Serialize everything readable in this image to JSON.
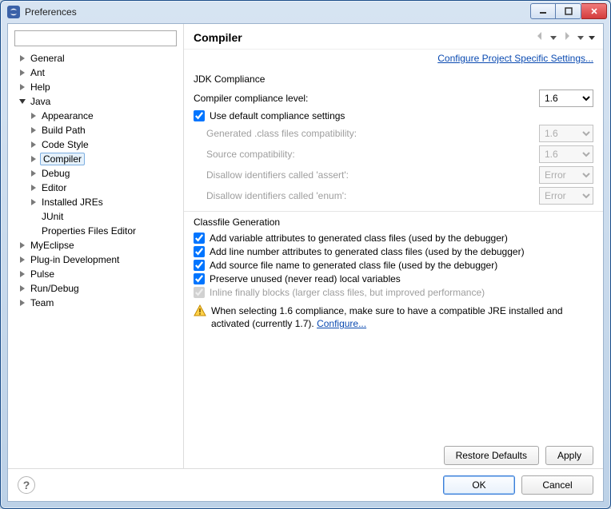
{
  "window": {
    "title": "Preferences"
  },
  "sidebar": {
    "filter_placeholder": "",
    "items": [
      {
        "label": "General",
        "expanded": false,
        "depth": 0
      },
      {
        "label": "Ant",
        "expanded": false,
        "depth": 0
      },
      {
        "label": "Help",
        "expanded": false,
        "depth": 0
      },
      {
        "label": "Java",
        "expanded": true,
        "depth": 0
      },
      {
        "label": "Appearance",
        "expanded": false,
        "depth": 1
      },
      {
        "label": "Build Path",
        "expanded": false,
        "depth": 1
      },
      {
        "label": "Code Style",
        "expanded": false,
        "depth": 1
      },
      {
        "label": "Compiler",
        "expanded": false,
        "depth": 1,
        "selected": true
      },
      {
        "label": "Debug",
        "expanded": false,
        "depth": 1
      },
      {
        "label": "Editor",
        "expanded": false,
        "depth": 1
      },
      {
        "label": "Installed JREs",
        "expanded": false,
        "depth": 1
      },
      {
        "label": "JUnit",
        "leaf": true,
        "depth": 1
      },
      {
        "label": "Properties Files Editor",
        "leaf": true,
        "depth": 1
      },
      {
        "label": "MyEclipse",
        "expanded": false,
        "depth": 0
      },
      {
        "label": "Plug-in Development",
        "expanded": false,
        "depth": 0
      },
      {
        "label": "Pulse",
        "expanded": false,
        "depth": 0
      },
      {
        "label": "Run/Debug",
        "expanded": false,
        "depth": 0
      },
      {
        "label": "Team",
        "expanded": false,
        "depth": 0
      }
    ]
  },
  "panel": {
    "title": "Compiler",
    "config_link": "Configure Project Specific Settings...",
    "jdk": {
      "group_title": "JDK Compliance",
      "compliance_label": "Compiler compliance level:",
      "compliance_value": "1.6",
      "use_default_label": "Use default compliance settings",
      "generated_label": "Generated .class files compatibility:",
      "generated_value": "1.6",
      "source_label": "Source compatibility:",
      "source_value": "1.6",
      "assert_label": "Disallow identifiers called 'assert':",
      "assert_value": "Error",
      "enum_label": "Disallow identifiers called 'enum':",
      "enum_value": "Error"
    },
    "classfile": {
      "group_title": "Classfile Generation",
      "add_var_label": "Add variable attributes to generated class files (used by the debugger)",
      "add_line_label": "Add line number attributes to generated class files (used by the debugger)",
      "add_source_label": "Add source file name to generated class file (used by the debugger)",
      "preserve_label": "Preserve unused (never read) local variables",
      "inline_label": "Inline finally blocks (larger class files, but improved performance)"
    },
    "warning_text": "When selecting 1.6 compliance, make sure to have a compatible JRE installed and activated (currently 1.7). ",
    "warning_link": "Configure...",
    "restore_label": "Restore Defaults",
    "apply_label": "Apply"
  },
  "footer": {
    "ok_label": "OK",
    "cancel_label": "Cancel"
  }
}
